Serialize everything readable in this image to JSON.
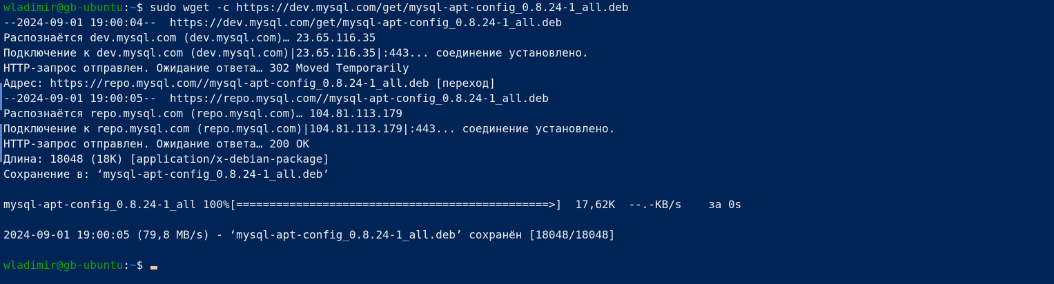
{
  "prompt1": {
    "user_host": "wladimir@gb-ubuntu",
    "separator": ":",
    "path": "~",
    "symbol": "$ ",
    "command": "sudo wget -c https://dev.mysql.com/get/mysql-apt-config_0.8.24-1_all.deb"
  },
  "output": [
    "--2024-09-01 19:00:04--  https://dev.mysql.com/get/mysql-apt-config_0.8.24-1_all.deb",
    "Распознаётся dev.mysql.com (dev.mysql.com)… 23.65.116.35",
    "Подключение к dev.mysql.com (dev.mysql.com)|23.65.116.35|:443... соединение установлено.",
    "HTTP-запрос отправлен. Ожидание ответа… 302 Moved Temporarily",
    "Адрес: https://repo.mysql.com//mysql-apt-config_0.8.24-1_all.deb [переход]",
    "--2024-09-01 19:00:05--  https://repo.mysql.com//mysql-apt-config_0.8.24-1_all.deb",
    "Распознаётся repo.mysql.com (repo.mysql.com)… 104.81.113.179",
    "Подключение к repo.mysql.com (repo.mysql.com)|104.81.113.179|:443... соединение установлено.",
    "HTTP-запрос отправлен. Ожидание ответа… 200 OK",
    "Длина: 18048 (18K) [application/x-debian-package]",
    "Сохранение в: ‘mysql-apt-config_0.8.24-1_all.deb’",
    "",
    "mysql-apt-config_0.8.24-1_all 100%[===============================================>]  17,62K  --.-KB/s    за 0s",
    "",
    "2024-09-01 19:00:05 (79,8 MB/s) - ‘mysql-apt-config_0.8.24-1_all.deb’ сохранён [18048/18048]",
    ""
  ],
  "prompt2": {
    "user_host": "wladimir@gb-ubuntu",
    "separator": ":",
    "path": "~",
    "symbol": "$ ",
    "command": ""
  },
  "colors": {
    "background": "#012456",
    "text": "#eeedf0",
    "user_host": "#13a10e",
    "path": "#3b78ff",
    "cursor": "#f2c79b"
  }
}
